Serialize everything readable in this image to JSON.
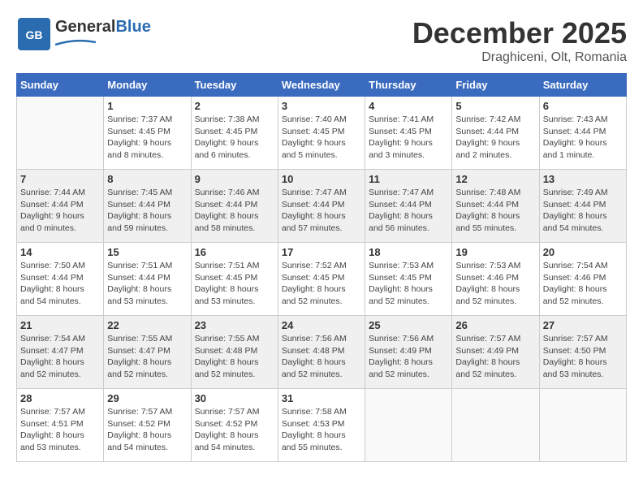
{
  "header": {
    "logo_general": "General",
    "logo_blue": "Blue",
    "month_title": "December 2025",
    "location": "Draghiceni, Olt, Romania"
  },
  "weekdays": [
    "Sunday",
    "Monday",
    "Tuesday",
    "Wednesday",
    "Thursday",
    "Friday",
    "Saturday"
  ],
  "weeks": [
    [
      {
        "day": "",
        "sunrise": "",
        "sunset": "",
        "daylight": "",
        "empty": true
      },
      {
        "day": "1",
        "sunrise": "Sunrise: 7:37 AM",
        "sunset": "Sunset: 4:45 PM",
        "daylight": "Daylight: 9 hours and 8 minutes."
      },
      {
        "day": "2",
        "sunrise": "Sunrise: 7:38 AM",
        "sunset": "Sunset: 4:45 PM",
        "daylight": "Daylight: 9 hours and 6 minutes."
      },
      {
        "day": "3",
        "sunrise": "Sunrise: 7:40 AM",
        "sunset": "Sunset: 4:45 PM",
        "daylight": "Daylight: 9 hours and 5 minutes."
      },
      {
        "day": "4",
        "sunrise": "Sunrise: 7:41 AM",
        "sunset": "Sunset: 4:45 PM",
        "daylight": "Daylight: 9 hours and 3 minutes."
      },
      {
        "day": "5",
        "sunrise": "Sunrise: 7:42 AM",
        "sunset": "Sunset: 4:44 PM",
        "daylight": "Daylight: 9 hours and 2 minutes."
      },
      {
        "day": "6",
        "sunrise": "Sunrise: 7:43 AM",
        "sunset": "Sunset: 4:44 PM",
        "daylight": "Daylight: 9 hours and 1 minute."
      }
    ],
    [
      {
        "day": "7",
        "sunrise": "Sunrise: 7:44 AM",
        "sunset": "Sunset: 4:44 PM",
        "daylight": "Daylight: 9 hours and 0 minutes."
      },
      {
        "day": "8",
        "sunrise": "Sunrise: 7:45 AM",
        "sunset": "Sunset: 4:44 PM",
        "daylight": "Daylight: 8 hours and 59 minutes."
      },
      {
        "day": "9",
        "sunrise": "Sunrise: 7:46 AM",
        "sunset": "Sunset: 4:44 PM",
        "daylight": "Daylight: 8 hours and 58 minutes."
      },
      {
        "day": "10",
        "sunrise": "Sunrise: 7:47 AM",
        "sunset": "Sunset: 4:44 PM",
        "daylight": "Daylight: 8 hours and 57 minutes."
      },
      {
        "day": "11",
        "sunrise": "Sunrise: 7:47 AM",
        "sunset": "Sunset: 4:44 PM",
        "daylight": "Daylight: 8 hours and 56 minutes."
      },
      {
        "day": "12",
        "sunrise": "Sunrise: 7:48 AM",
        "sunset": "Sunset: 4:44 PM",
        "daylight": "Daylight: 8 hours and 55 minutes."
      },
      {
        "day": "13",
        "sunrise": "Sunrise: 7:49 AM",
        "sunset": "Sunset: 4:44 PM",
        "daylight": "Daylight: 8 hours and 54 minutes."
      }
    ],
    [
      {
        "day": "14",
        "sunrise": "Sunrise: 7:50 AM",
        "sunset": "Sunset: 4:44 PM",
        "daylight": "Daylight: 8 hours and 54 minutes."
      },
      {
        "day": "15",
        "sunrise": "Sunrise: 7:51 AM",
        "sunset": "Sunset: 4:44 PM",
        "daylight": "Daylight: 8 hours and 53 minutes."
      },
      {
        "day": "16",
        "sunrise": "Sunrise: 7:51 AM",
        "sunset": "Sunset: 4:45 PM",
        "daylight": "Daylight: 8 hours and 53 minutes."
      },
      {
        "day": "17",
        "sunrise": "Sunrise: 7:52 AM",
        "sunset": "Sunset: 4:45 PM",
        "daylight": "Daylight: 8 hours and 52 minutes."
      },
      {
        "day": "18",
        "sunrise": "Sunrise: 7:53 AM",
        "sunset": "Sunset: 4:45 PM",
        "daylight": "Daylight: 8 hours and 52 minutes."
      },
      {
        "day": "19",
        "sunrise": "Sunrise: 7:53 AM",
        "sunset": "Sunset: 4:46 PM",
        "daylight": "Daylight: 8 hours and 52 minutes."
      },
      {
        "day": "20",
        "sunrise": "Sunrise: 7:54 AM",
        "sunset": "Sunset: 4:46 PM",
        "daylight": "Daylight: 8 hours and 52 minutes."
      }
    ],
    [
      {
        "day": "21",
        "sunrise": "Sunrise: 7:54 AM",
        "sunset": "Sunset: 4:47 PM",
        "daylight": "Daylight: 8 hours and 52 minutes."
      },
      {
        "day": "22",
        "sunrise": "Sunrise: 7:55 AM",
        "sunset": "Sunset: 4:47 PM",
        "daylight": "Daylight: 8 hours and 52 minutes."
      },
      {
        "day": "23",
        "sunrise": "Sunrise: 7:55 AM",
        "sunset": "Sunset: 4:48 PM",
        "daylight": "Daylight: 8 hours and 52 minutes."
      },
      {
        "day": "24",
        "sunrise": "Sunrise: 7:56 AM",
        "sunset": "Sunset: 4:48 PM",
        "daylight": "Daylight: 8 hours and 52 minutes."
      },
      {
        "day": "25",
        "sunrise": "Sunrise: 7:56 AM",
        "sunset": "Sunset: 4:49 PM",
        "daylight": "Daylight: 8 hours and 52 minutes."
      },
      {
        "day": "26",
        "sunrise": "Sunrise: 7:57 AM",
        "sunset": "Sunset: 4:49 PM",
        "daylight": "Daylight: 8 hours and 52 minutes."
      },
      {
        "day": "27",
        "sunrise": "Sunrise: 7:57 AM",
        "sunset": "Sunset: 4:50 PM",
        "daylight": "Daylight: 8 hours and 53 minutes."
      }
    ],
    [
      {
        "day": "28",
        "sunrise": "Sunrise: 7:57 AM",
        "sunset": "Sunset: 4:51 PM",
        "daylight": "Daylight: 8 hours and 53 minutes."
      },
      {
        "day": "29",
        "sunrise": "Sunrise: 7:57 AM",
        "sunset": "Sunset: 4:52 PM",
        "daylight": "Daylight: 8 hours and 54 minutes."
      },
      {
        "day": "30",
        "sunrise": "Sunrise: 7:57 AM",
        "sunset": "Sunset: 4:52 PM",
        "daylight": "Daylight: 8 hours and 54 minutes."
      },
      {
        "day": "31",
        "sunrise": "Sunrise: 7:58 AM",
        "sunset": "Sunset: 4:53 PM",
        "daylight": "Daylight: 8 hours and 55 minutes."
      },
      {
        "day": "",
        "sunrise": "",
        "sunset": "",
        "daylight": "",
        "empty": true
      },
      {
        "day": "",
        "sunrise": "",
        "sunset": "",
        "daylight": "",
        "empty": true
      },
      {
        "day": "",
        "sunrise": "",
        "sunset": "",
        "daylight": "",
        "empty": true
      }
    ]
  ]
}
